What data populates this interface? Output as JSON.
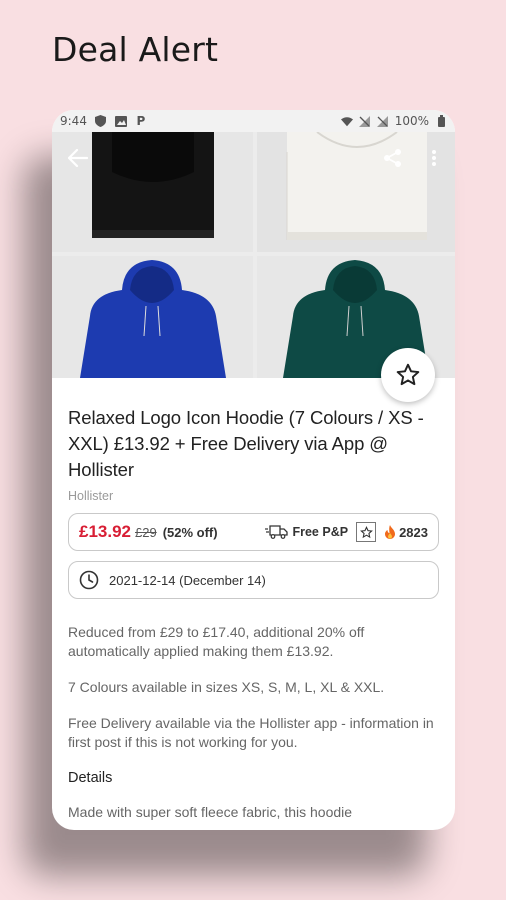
{
  "promo": {
    "title": "Deal Alert"
  },
  "status_bar": {
    "time": "9:44",
    "battery": "100%"
  },
  "toolbar": {
    "back_icon": "back-arrow-icon",
    "share_icon": "share-icon",
    "more_icon": "more-vert-icon"
  },
  "gallery": {
    "images": [
      {
        "name": "black hoodie",
        "color": "#141414"
      },
      {
        "name": "white hoodie",
        "color": "#e9e8e3"
      },
      {
        "name": "blue hoodie",
        "color": "#1d3bb0"
      },
      {
        "name": "green hoodie",
        "color": "#0e4a45"
      }
    ]
  },
  "deal": {
    "title": "Relaxed Logo Icon Hoodie (7 Colours / XS - XXL) £13.92 + Free Delivery via App @ Hollister",
    "merchant": "Hollister",
    "price": "£13.92",
    "old_price": "£29",
    "discount": "(52% off)",
    "delivery": "Free P&P",
    "temperature": "2823",
    "date": "2021-12-14 (December 14)",
    "description": [
      "Reduced from £29 to £17.40, additional 20% off automatically applied making them £13.92.",
      "7 Colours available in sizes XS, S, M, L, XL & XXL.",
      "Free Delivery available via the Hollister app - information in first post if this is not working for you."
    ],
    "details_heading": "Details",
    "details_text": "Made with super soft fleece fabric, this hoodie"
  },
  "colors": {
    "price_red": "#d81e34",
    "flame_orange": "#f06a1c",
    "background_pink": "#f9dfe2"
  }
}
